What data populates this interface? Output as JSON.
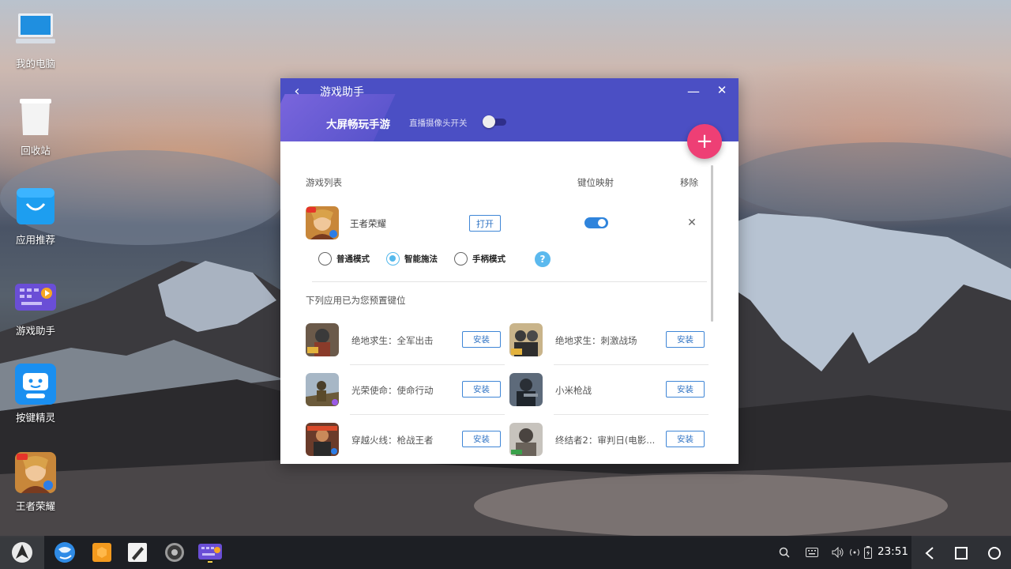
{
  "desktop": {
    "icons": [
      {
        "label": "我的电脑",
        "icon": "computer-icon"
      },
      {
        "label": "回收站",
        "icon": "recycle-bin-icon"
      },
      {
        "label": "应用推荐",
        "icon": "app-store-bag-icon"
      },
      {
        "label": "游戏助手",
        "icon": "game-assistant-keyboard-icon"
      },
      {
        "label": "按键精灵",
        "icon": "robot-face-icon"
      },
      {
        "label": "王者荣耀",
        "icon": "game-avatar-icon"
      }
    ]
  },
  "window": {
    "title": "游戏助手",
    "header_subtitle": "大屏畅玩手游",
    "camera_toggle_label": "直播摄像头开关",
    "camera_toggle_on": false,
    "accent": "#4b4fc4",
    "fab_color": "#ee3f75",
    "list_header": {
      "games": "游戏列表",
      "keymap": "键位映射",
      "remove": "移除"
    },
    "installed_game": {
      "name": "王者荣耀",
      "open_label": "打开",
      "keymap_on": true
    },
    "modes": [
      {
        "label": "普通模式",
        "checked": false
      },
      {
        "label": "智能施法",
        "checked": true
      },
      {
        "label": "手柄模式",
        "checked": false
      }
    ],
    "help_label": "?",
    "preset_title": "下列应用已为您预置键位",
    "presets": [
      {
        "name": "绝地求生：全军出击",
        "install": "安装"
      },
      {
        "name": "绝地求生：刺激战场",
        "install": "安装"
      },
      {
        "name": "光荣使命：使命行动",
        "install": "安装"
      },
      {
        "name": "小米枪战",
        "install": "安装"
      },
      {
        "name": "穿越火线：枪战王者",
        "install": "安装"
      },
      {
        "name": "终结者2：审判日(电影...",
        "install": "安装"
      }
    ]
  },
  "taskbar": {
    "apps": [
      "browser-globe-icon",
      "files-folder-icon",
      "editor-icon",
      "settings-gear-icon",
      "game-assistant-keyboard-icon"
    ],
    "tray": [
      "search-icon",
      "keyboard-icon",
      "volume-icon",
      "network-icon",
      "battery-icon"
    ],
    "clock": "23:51"
  }
}
